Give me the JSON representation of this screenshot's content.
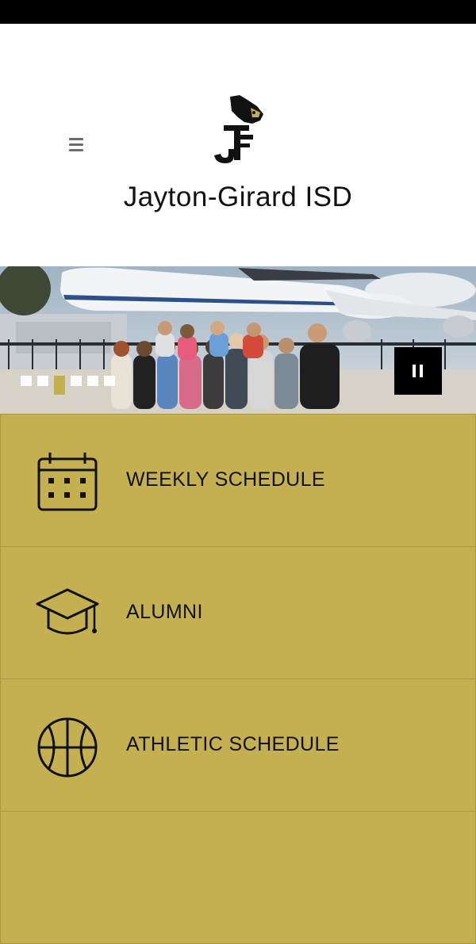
{
  "site": {
    "title": "Jayton-Girard ISD"
  },
  "slideshow": {
    "dots": [
      {
        "active": false
      },
      {
        "active": false
      },
      {
        "active": true
      },
      {
        "active": false
      },
      {
        "active": false
      },
      {
        "active": false
      }
    ],
    "pause_icon": "pause-icon"
  },
  "quick_links": [
    {
      "label": "WEEKLY SCHEDULE",
      "icon": "calendar-icon"
    },
    {
      "label": "ALUMNI",
      "icon": "graduation-cap-icon"
    },
    {
      "label": "ATHLETIC SCHEDULE",
      "icon": "basketball-icon"
    },
    {
      "label": "",
      "icon": ""
    }
  ],
  "colors": {
    "accent": "#c4b050",
    "text": "#111111",
    "header_bg": "#ffffff"
  }
}
